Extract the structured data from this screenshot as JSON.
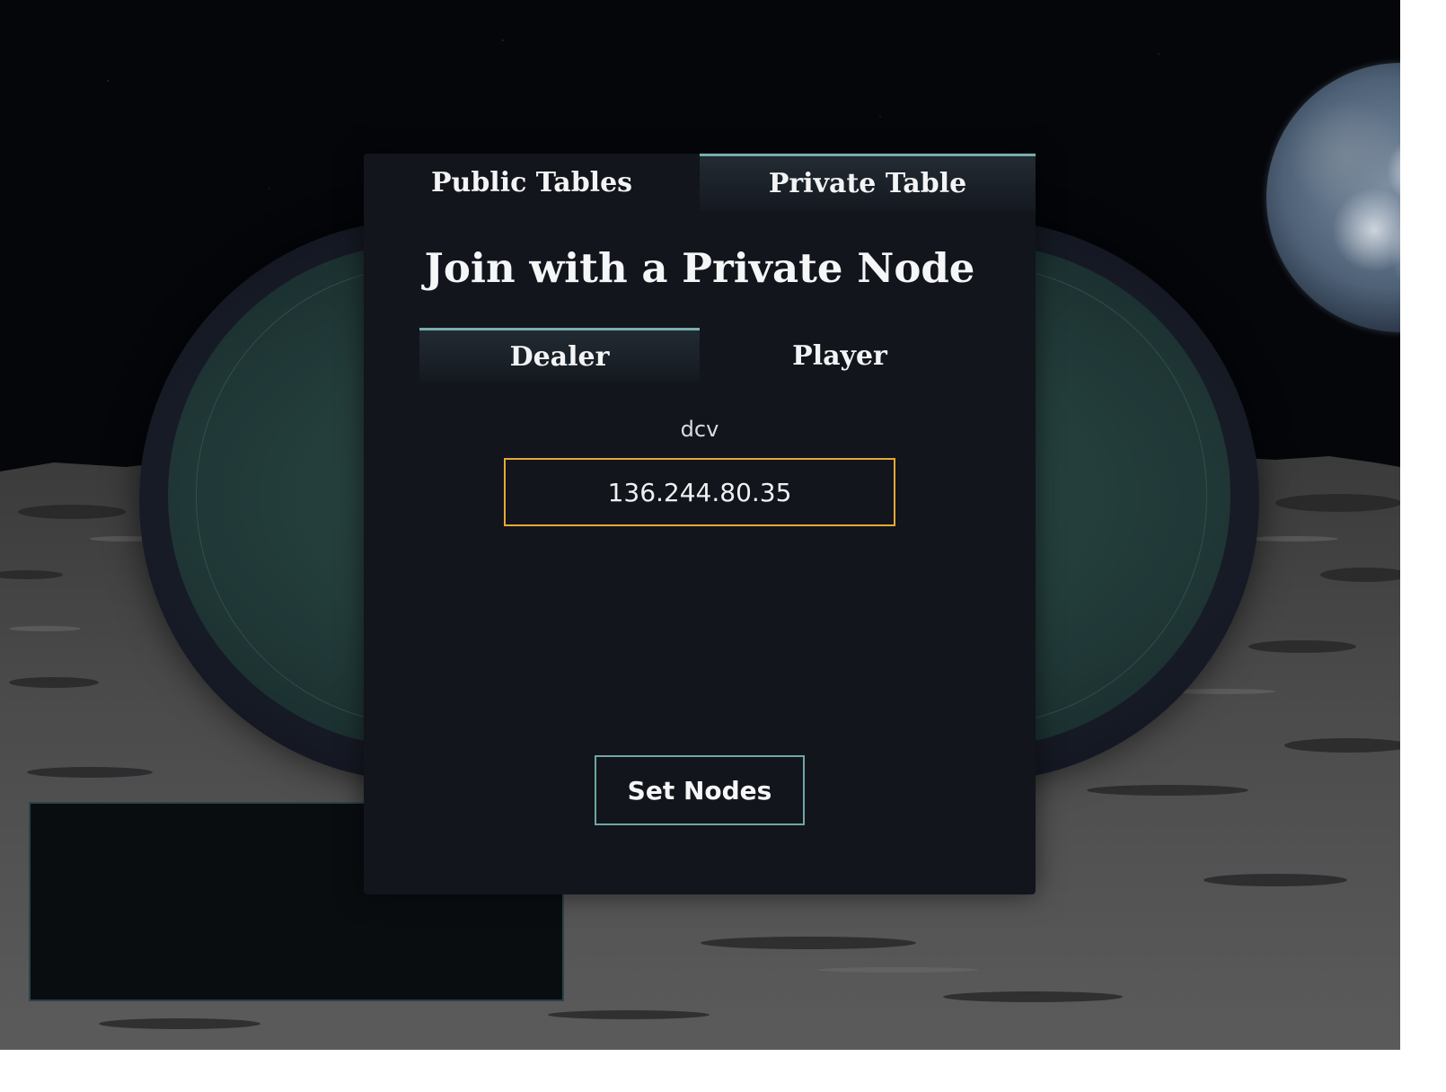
{
  "tabs": {
    "public_label": "Public Tables",
    "private_label": "Private Table",
    "active": "private"
  },
  "modal": {
    "title": "Join with a Private Node"
  },
  "roles": {
    "dealer_label": "Dealer",
    "player_label": "Player",
    "active": "dealer"
  },
  "form": {
    "label": "dcv",
    "value": "136.244.80.35"
  },
  "actions": {
    "set_nodes_label": "Set Nodes"
  },
  "colors": {
    "accent": "#79aeae",
    "input_border": "#e6a935",
    "panel_bg": "#12151b"
  }
}
